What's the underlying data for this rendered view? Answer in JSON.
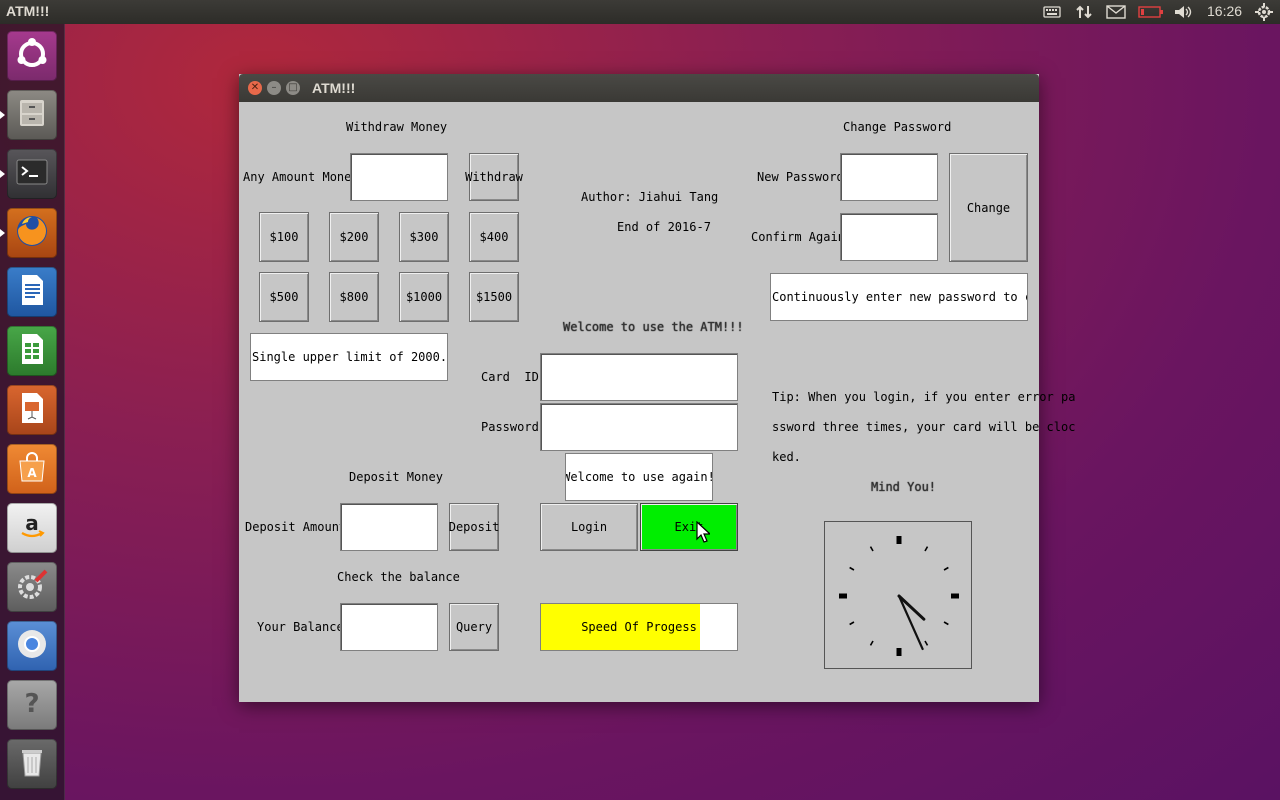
{
  "top_panel": {
    "app_title": "ATM!!!",
    "time": "16:26"
  },
  "launcher": {
    "items": [
      "ubuntu-dash",
      "files",
      "terminal",
      "firefox",
      "libreoffice-writer",
      "libreoffice-calc",
      "libreoffice-impress",
      "software-center",
      "amazon",
      "system-settings",
      "chromium",
      "help",
      "trash"
    ]
  },
  "window": {
    "title": "ATM!!!",
    "withdraw": {
      "heading": "Withdraw Money",
      "amount_label": "Any Amount Money:",
      "amount_value": "",
      "withdraw_button": "Withdraw",
      "quick_amounts": [
        "$100",
        "$200",
        "$300",
        "$400",
        "$500",
        "$800",
        "$1000",
        "$1500"
      ],
      "limit_message": "Single upper limit of 2000."
    },
    "author": {
      "line1": "Author: Jiahui Tang",
      "line2": "End of 2016-7"
    },
    "change_password": {
      "heading": "Change Password",
      "new_label": "New Password:",
      "confirm_label": "Confirm Again:",
      "change_button": "Change",
      "message": "Continuously enter new password to change"
    },
    "login": {
      "welcome": "Welcome to use the ATM!!!",
      "card_label": "Card  ID:",
      "password_label": "Password:",
      "message": "Welcome to use again!",
      "login_button": "Login",
      "exit_button": "Exit"
    },
    "tip": {
      "line1": "Tip: When you login, if you enter error pa",
      "line2": "ssword three times, your card will be cloc",
      "line3": "ked.",
      "mind": "Mind You!"
    },
    "deposit": {
      "heading": "Deposit Money",
      "amount_label": "Deposit Amount:",
      "deposit_button": "Deposit"
    },
    "balance": {
      "heading": "Check the balance",
      "label": "Your Balance:",
      "query_button": "Query"
    },
    "progress": {
      "label": "Speed Of Progess",
      "fraction": 0.81
    },
    "colors": {
      "exit_button": "#00ee00",
      "progress_fill": "#ffff00"
    }
  }
}
